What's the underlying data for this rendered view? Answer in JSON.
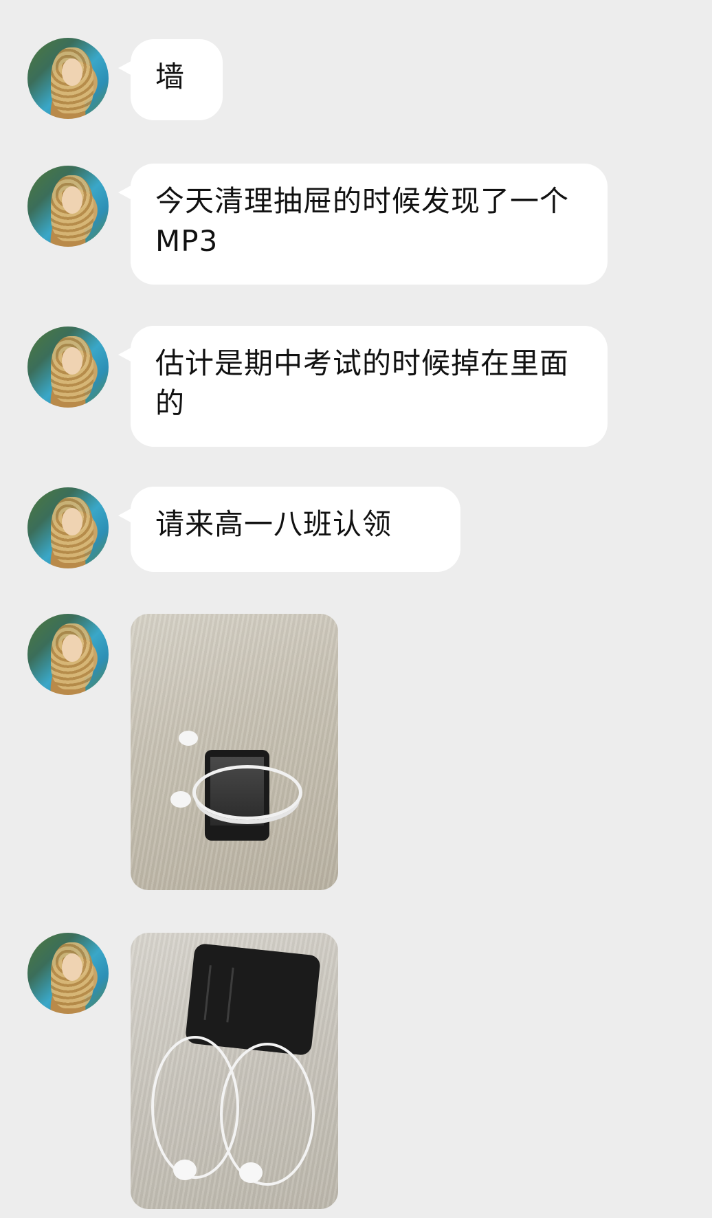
{
  "messages": [
    {
      "type": "text",
      "text": "墙"
    },
    {
      "type": "text",
      "text": "今天清理抽屉的时候发现了一个MP3"
    },
    {
      "type": "text",
      "text": "估计是期中考试的时候掉在里面的"
    },
    {
      "type": "text",
      "text": "请来高一八班认领"
    },
    {
      "type": "image",
      "subject": "MP3 player with white earphones on a desk"
    },
    {
      "type": "image",
      "subject": "Black MP3 player with white earphones on a desk"
    }
  ],
  "colors": {
    "background": "#ededed",
    "bubble": "#ffffff",
    "text": "#111111"
  }
}
